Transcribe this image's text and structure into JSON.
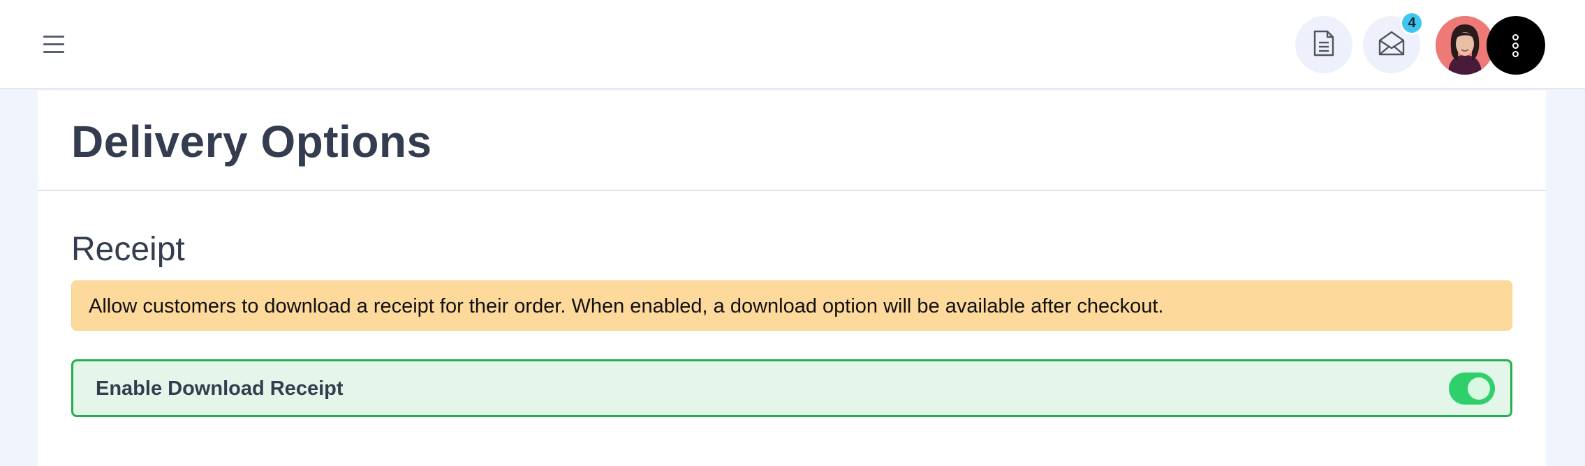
{
  "topbar": {
    "menu_icon": "hamburger-menu-icon",
    "document_icon": "document-icon",
    "mail_icon": "envelope-open-icon",
    "mail_badge": "4",
    "more_icon": "more-vertical-icon",
    "colors": {
      "badge": "#3dc7ee",
      "avatar_bg": "#ee7a78"
    }
  },
  "page": {
    "title": "Delivery Options",
    "section_title": "Receipt",
    "notice": "Allow customers to download a receipt for their order. When enabled, a download option will be available after checkout.",
    "toggle": {
      "label": "Enable Download Receipt",
      "enabled": true,
      "color": "#2fd06b"
    }
  }
}
